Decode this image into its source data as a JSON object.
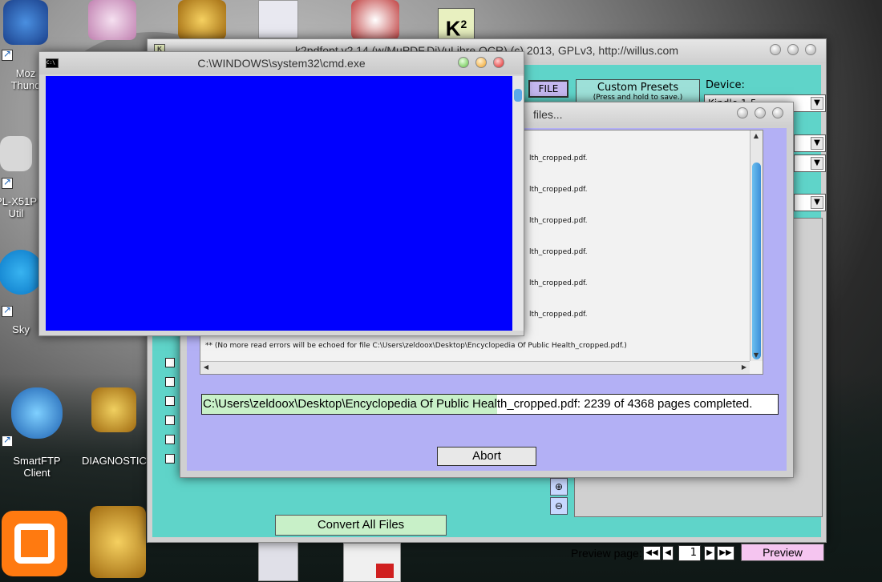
{
  "desktop": {
    "icons": [
      {
        "label": "Moz\nThund"
      },
      {
        "label": "PL-X51P\nUtil"
      },
      {
        "label": "Sky"
      },
      {
        "label": "SmartFTP\nClient"
      },
      {
        "label": "DIAGNOSTIC"
      }
    ]
  },
  "k2": {
    "title": "k2pdfopt v2.14 (w/MuPDF,DjVuLibre,OCR) (c) 2013, GPLv3, http://willus.com",
    "file_label": "FILE",
    "presets_title": "Custom Presets",
    "presets_hint": "(Press and hold to save.)",
    "device_label": "Device:",
    "device_value": "Kindle 1-5",
    "convert_label": "Convert All Files",
    "preview_page_label": "Preview page:",
    "page_value": "1",
    "preview_label": "Preview"
  },
  "proc": {
    "title": "files...",
    "log_lines": [
      "lth_cropped.pdf.",
      "lth_cropped.pdf.",
      "lth_cropped.pdf.",
      "lth_cropped.pdf.",
      "lth_cropped.pdf.",
      "lth_cropped.pdf."
    ],
    "last_line": "** (No more read errors will be echoed for file C:\\Users\\zeldoox\\Desktop\\Encyclopedia Of Public Health_cropped.pdf.)",
    "status_text": "C:\\Users\\zeldoox\\Desktop\\Encyclopedia Of Public Health_cropped.pdf: 2239 of 4368 pages completed.",
    "progress_fraction": 0.5126,
    "abort_label": "Abort"
  },
  "cmd": {
    "title": "C:\\WINDOWS\\system32\\cmd.exe",
    "icon_text": "C:\\",
    "bg_color": "#0000ff"
  }
}
